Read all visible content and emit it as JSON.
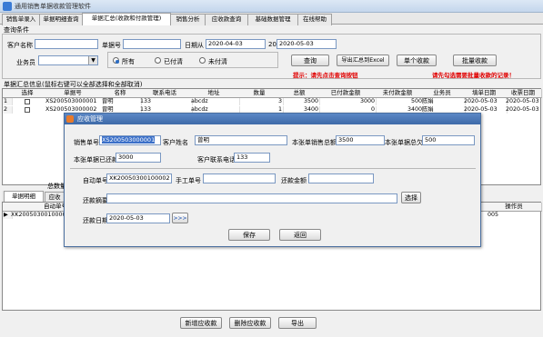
{
  "window": {
    "title": "通用销售单据收款管理软件"
  },
  "tabs": [
    "销售单录入",
    "单据明细查询",
    "单据汇总(收款和付款管理)",
    "销售分析",
    "应收款查询",
    "基础数据管理",
    "在线帮助"
  ],
  "query": {
    "section_label": "查询条件",
    "customer_label": "客户名称",
    "customer_value": "",
    "doc_no_label": "单据号",
    "doc_no_value": "",
    "date_from_label": "日期从",
    "date_from": "2020-04-03",
    "date_to_label": "到",
    "date_to": "2020-05-03",
    "salesman_label": "业务员",
    "salesman_value": "",
    "radio_all": "所有",
    "radio_paid": "已付清",
    "radio_unpaid": "未付清",
    "btn_query": "查询",
    "btn_export": "导出汇总到Excel",
    "btn_single": "单个收款",
    "btn_batch": "批量收款",
    "hint1": "提示：请先点击查询按钮",
    "hint2": "请先勾选需要批量收款的记录！"
  },
  "summary": {
    "section_label": "单据汇总信息(鼠标右键可以全部选择和全部取消)",
    "columns": [
      "选择",
      "单据号",
      "名称",
      "联系电话",
      "地址",
      "数量",
      "总额",
      "已付款金额",
      "未付款金额",
      "业务员",
      "填单日期",
      "收票日期"
    ],
    "rows": [
      [
        "1",
        "",
        "XS200503000001",
        "曾明",
        "133",
        "abcdz",
        "3",
        "3500",
        "3000",
        "500",
        "陈娟",
        "2020-05-03",
        "2020-05-03"
      ],
      [
        "2",
        "",
        "XS200503000002",
        "曾明",
        "133",
        "abcdz",
        "1",
        "3400",
        "0",
        "3400",
        "陈娟",
        "2020-05-03",
        "2020-05-03"
      ]
    ]
  },
  "lower": {
    "total_label": "总数量",
    "tab1": "单据明细",
    "tab2": "应收",
    "col_auto": "自动单号",
    "col_operator": "操作员",
    "row_auto": "XK20050300100001",
    "row_operator": "005",
    "btn_new": "新增应收款",
    "btn_delete": "删除应收款",
    "btn_export": "导出"
  },
  "dialog": {
    "title": "应收管理",
    "doc_no_label": "销售单号",
    "doc_no": "XS200503000001",
    "cust_label": "客户姓名",
    "cust": "曾明",
    "total_label": "本张单销售总额",
    "total": "3500",
    "owed_label": "本张单据总欠",
    "owed": "500",
    "received_label": "本张单据已还款",
    "received": "3000",
    "phone_label": "客户联系电话",
    "phone": "133",
    "auto_label": "自动单号",
    "auto_no": "XK20050300100002",
    "manual_label": "手工单号",
    "manual_no": "",
    "repay_label": "还款金额",
    "repay": "",
    "summary_label": "还款摘要",
    "summary": "",
    "btn_choose": "选择",
    "date_label": "还款日期",
    "date": "2020-05-03",
    "btn_more": ">>>",
    "btn_save": "保存",
    "btn_return": "返回"
  },
  "colors": {
    "accent": "#3e6aa8",
    "warning": "#e00000"
  }
}
